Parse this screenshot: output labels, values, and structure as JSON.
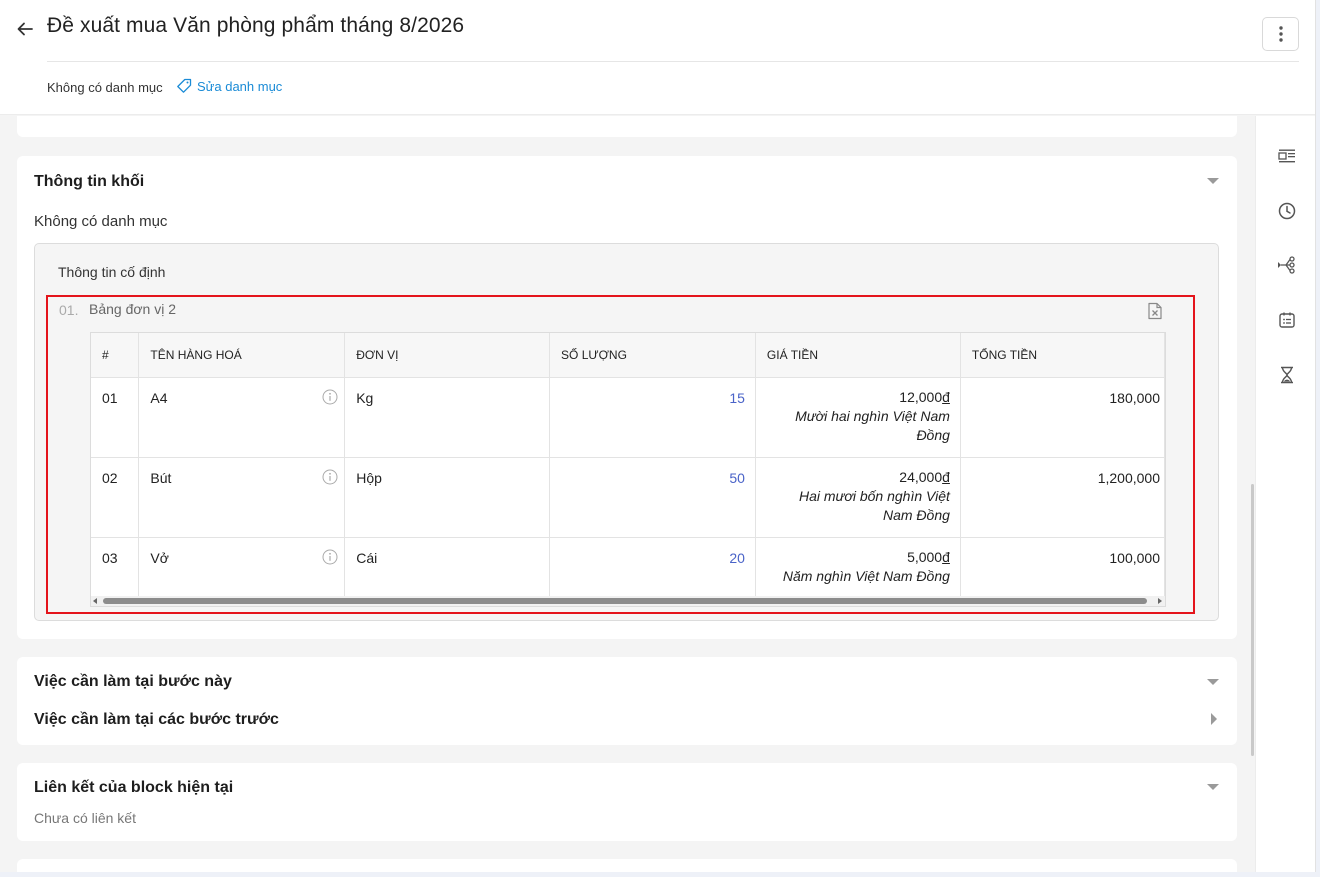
{
  "header": {
    "title": "Đề xuất mua Văn phòng phẩm tháng 8/2026",
    "category_label": "Không có danh mục",
    "edit_category_label": "Sửa danh mục"
  },
  "block_info": {
    "title": "Thông tin khối",
    "category_text": "Không có danh mục",
    "fixed_info_title": "Thông tin cố định",
    "table": {
      "index_label": "01.",
      "name": "Bảng đơn vị 2",
      "columns": [
        "#",
        "TÊN HÀNG HOÁ",
        "ĐƠN VỊ",
        "SỐ LƯỢNG",
        "GIÁ TIỀN",
        "TỔNG TIỀN"
      ],
      "rows": [
        {
          "no": "01",
          "item": "A4",
          "unit": "Kg",
          "qty": "15",
          "price": "12,000",
          "currency": "đ",
          "price_words": "Mười hai nghìn Việt Nam Đồng",
          "total": "180,000"
        },
        {
          "no": "02",
          "item": "Bút",
          "unit": "Hộp",
          "qty": "50",
          "price": "24,000",
          "currency": "đ",
          "price_words": "Hai mươi bốn nghìn Việt Nam Đồng",
          "total": "1,200,000"
        },
        {
          "no": "03",
          "item": "Vở",
          "unit": "Cái",
          "qty": "20",
          "price": "5,000",
          "currency": "đ",
          "price_words": "Năm nghìn Việt Nam Đồng",
          "total": "100,000"
        }
      ]
    }
  },
  "todo": {
    "current_step_title": "Việc cần làm tại bước này",
    "previous_steps_title": "Việc cần làm tại các bước trước"
  },
  "links": {
    "title": "Liên kết của block hiện tại",
    "empty_text": "Chưa có liên kết"
  },
  "sidebar": {
    "icons": [
      "detail-panel-icon",
      "history-clock-icon",
      "workflow-branch-icon",
      "task-list-icon",
      "hourglass-icon"
    ]
  },
  "colors": {
    "accent_link": "#1a8bd6",
    "quantity_text": "#4a63c8",
    "highlight_frame": "#e4141b"
  }
}
